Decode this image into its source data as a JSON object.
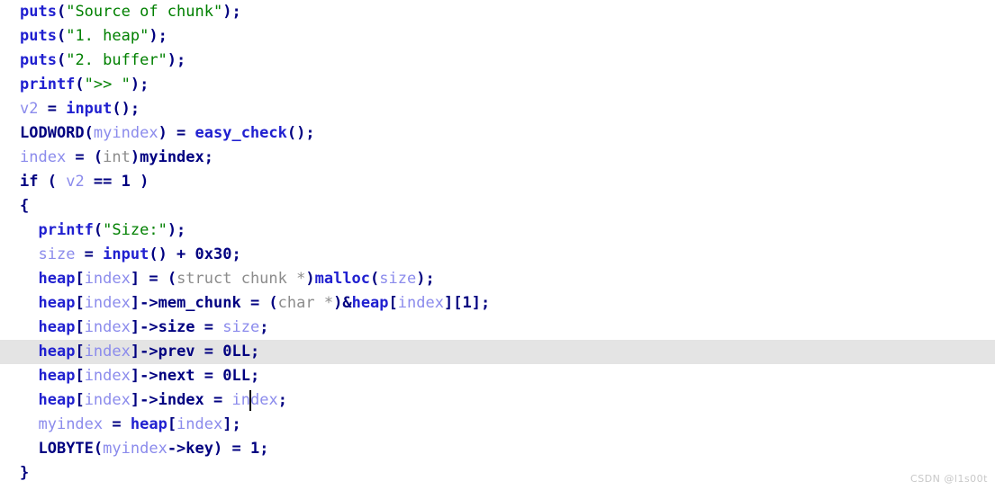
{
  "editor": {
    "kind": "decompiler-pseudocode",
    "language": "C",
    "background_color": "#ffffff",
    "highlight_color": "#e4e4e4",
    "cursor": {
      "visible": true,
      "line_number": 17,
      "column": 26
    },
    "colors": {
      "function": "#2020d0",
      "keyword": "#000080",
      "string": "#008000",
      "local_variable": "#8b8bec",
      "cast_type": "#8c8c8c",
      "number": "#000080"
    }
  },
  "lines": [
    {
      "n": 1,
      "highlighted": false,
      "tokens": [
        {
          "t": "puts",
          "c": "func"
        },
        {
          "t": "(",
          "c": "punct"
        },
        {
          "t": "\"Source of chunk\"",
          "c": "str"
        },
        {
          "t": ");",
          "c": "punct"
        }
      ]
    },
    {
      "n": 2,
      "highlighted": false,
      "tokens": [
        {
          "t": "puts",
          "c": "func"
        },
        {
          "t": "(",
          "c": "punct"
        },
        {
          "t": "\"1. heap\"",
          "c": "str"
        },
        {
          "t": ");",
          "c": "punct"
        }
      ]
    },
    {
      "n": 3,
      "highlighted": false,
      "tokens": [
        {
          "t": "puts",
          "c": "func"
        },
        {
          "t": "(",
          "c": "punct"
        },
        {
          "t": "\"2. buffer\"",
          "c": "str"
        },
        {
          "t": ");",
          "c": "punct"
        }
      ]
    },
    {
      "n": 4,
      "highlighted": false,
      "tokens": [
        {
          "t": "printf",
          "c": "func"
        },
        {
          "t": "(",
          "c": "punct"
        },
        {
          "t": "\">> \"",
          "c": "str"
        },
        {
          "t": ");",
          "c": "punct"
        }
      ]
    },
    {
      "n": 5,
      "highlighted": false,
      "tokens": [
        {
          "t": "v2",
          "c": "local"
        },
        {
          "t": " = ",
          "c": "punct"
        },
        {
          "t": "input",
          "c": "func"
        },
        {
          "t": "();",
          "c": "punct"
        }
      ]
    },
    {
      "n": 6,
      "highlighted": false,
      "tokens": [
        {
          "t": "LODWORD",
          "c": "key"
        },
        {
          "t": "(",
          "c": "punct"
        },
        {
          "t": "myindex",
          "c": "local"
        },
        {
          "t": ") = ",
          "c": "punct"
        },
        {
          "t": "easy_check",
          "c": "func"
        },
        {
          "t": "();",
          "c": "punct"
        }
      ]
    },
    {
      "n": 7,
      "highlighted": false,
      "tokens": [
        {
          "t": "index",
          "c": "local"
        },
        {
          "t": " = (",
          "c": "punct"
        },
        {
          "t": "int",
          "c": "cast"
        },
        {
          "t": ")",
          "c": "punct"
        },
        {
          "t": "myindex",
          "c": "key"
        },
        {
          "t": ";",
          "c": "punct"
        }
      ]
    },
    {
      "n": 8,
      "highlighted": false,
      "tokens": [
        {
          "t": "if",
          "c": "key"
        },
        {
          "t": " ( ",
          "c": "punct"
        },
        {
          "t": "v2",
          "c": "local"
        },
        {
          "t": " == ",
          "c": "punct"
        },
        {
          "t": "1",
          "c": "num"
        },
        {
          "t": " )",
          "c": "punct"
        }
      ]
    },
    {
      "n": 9,
      "highlighted": false,
      "tokens": [
        {
          "t": "{",
          "c": "punct"
        }
      ]
    },
    {
      "n": 10,
      "highlighted": false,
      "tokens": [
        {
          "t": "  ",
          "c": "plain"
        },
        {
          "t": "printf",
          "c": "func"
        },
        {
          "t": "(",
          "c": "punct"
        },
        {
          "t": "\"Size:\"",
          "c": "str"
        },
        {
          "t": ");",
          "c": "punct"
        }
      ]
    },
    {
      "n": 11,
      "highlighted": false,
      "tokens": [
        {
          "t": "  ",
          "c": "plain"
        },
        {
          "t": "size",
          "c": "local"
        },
        {
          "t": " = ",
          "c": "punct"
        },
        {
          "t": "input",
          "c": "func"
        },
        {
          "t": "() + ",
          "c": "punct"
        },
        {
          "t": "0x30",
          "c": "num"
        },
        {
          "t": ";",
          "c": "punct"
        }
      ]
    },
    {
      "n": 12,
      "highlighted": false,
      "tokens": [
        {
          "t": "  ",
          "c": "plain"
        },
        {
          "t": "heap",
          "c": "func"
        },
        {
          "t": "[",
          "c": "punct"
        },
        {
          "t": "index",
          "c": "local"
        },
        {
          "t": "] = (",
          "c": "punct"
        },
        {
          "t": "struct chunk *",
          "c": "cast"
        },
        {
          "t": ")",
          "c": "punct"
        },
        {
          "t": "malloc",
          "c": "func"
        },
        {
          "t": "(",
          "c": "punct"
        },
        {
          "t": "size",
          "c": "local"
        },
        {
          "t": ");",
          "c": "punct"
        }
      ]
    },
    {
      "n": 13,
      "highlighted": false,
      "tokens": [
        {
          "t": "  ",
          "c": "plain"
        },
        {
          "t": "heap",
          "c": "func"
        },
        {
          "t": "[",
          "c": "punct"
        },
        {
          "t": "index",
          "c": "local"
        },
        {
          "t": "]->",
          "c": "punct"
        },
        {
          "t": "mem_chunk",
          "c": "key"
        },
        {
          "t": " = (",
          "c": "punct"
        },
        {
          "t": "char *",
          "c": "cast"
        },
        {
          "t": ")&",
          "c": "punct"
        },
        {
          "t": "heap",
          "c": "func"
        },
        {
          "t": "[",
          "c": "punct"
        },
        {
          "t": "index",
          "c": "local"
        },
        {
          "t": "][",
          "c": "punct"
        },
        {
          "t": "1",
          "c": "num"
        },
        {
          "t": "];",
          "c": "punct"
        }
      ]
    },
    {
      "n": 14,
      "highlighted": false,
      "tokens": [
        {
          "t": "  ",
          "c": "plain"
        },
        {
          "t": "heap",
          "c": "func"
        },
        {
          "t": "[",
          "c": "punct"
        },
        {
          "t": "index",
          "c": "local"
        },
        {
          "t": "]->",
          "c": "punct"
        },
        {
          "t": "size",
          "c": "key"
        },
        {
          "t": " = ",
          "c": "punct"
        },
        {
          "t": "size",
          "c": "local"
        },
        {
          "t": ";",
          "c": "punct"
        }
      ]
    },
    {
      "n": 15,
      "highlighted": true,
      "tokens": [
        {
          "t": "  ",
          "c": "plain"
        },
        {
          "t": "heap",
          "c": "func"
        },
        {
          "t": "[",
          "c": "punct"
        },
        {
          "t": "index",
          "c": "local"
        },
        {
          "t": "]->",
          "c": "punct"
        },
        {
          "t": "prev",
          "c": "key"
        },
        {
          "t": " = ",
          "c": "punct"
        },
        {
          "t": "0LL",
          "c": "num"
        },
        {
          "t": ";",
          "c": "punct"
        }
      ]
    },
    {
      "n": 16,
      "highlighted": false,
      "tokens": [
        {
          "t": "  ",
          "c": "plain"
        },
        {
          "t": "heap",
          "c": "func"
        },
        {
          "t": "[",
          "c": "punct"
        },
        {
          "t": "index",
          "c": "local"
        },
        {
          "t": "]->",
          "c": "punct"
        },
        {
          "t": "next",
          "c": "key"
        },
        {
          "t": " = ",
          "c": "punct"
        },
        {
          "t": "0LL",
          "c": "num"
        },
        {
          "t": ";",
          "c": "punct"
        }
      ]
    },
    {
      "n": 17,
      "highlighted": false,
      "tokens": [
        {
          "t": "  ",
          "c": "plain"
        },
        {
          "t": "heap",
          "c": "func"
        },
        {
          "t": "[",
          "c": "punct"
        },
        {
          "t": "index",
          "c": "local"
        },
        {
          "t": "]->",
          "c": "punct"
        },
        {
          "t": "index",
          "c": "key"
        },
        {
          "t": " = ",
          "c": "punct"
        },
        {
          "t": "index",
          "c": "local"
        },
        {
          "t": ";",
          "c": "punct"
        }
      ]
    },
    {
      "n": 18,
      "highlighted": false,
      "tokens": [
        {
          "t": "  ",
          "c": "plain"
        },
        {
          "t": "myindex",
          "c": "local"
        },
        {
          "t": " = ",
          "c": "punct"
        },
        {
          "t": "heap",
          "c": "func"
        },
        {
          "t": "[",
          "c": "punct"
        },
        {
          "t": "index",
          "c": "local"
        },
        {
          "t": "];",
          "c": "punct"
        }
      ]
    },
    {
      "n": 19,
      "highlighted": false,
      "tokens": [
        {
          "t": "  ",
          "c": "plain"
        },
        {
          "t": "LOBYTE",
          "c": "key"
        },
        {
          "t": "(",
          "c": "punct"
        },
        {
          "t": "myindex",
          "c": "local"
        },
        {
          "t": "->",
          "c": "punct"
        },
        {
          "t": "key",
          "c": "key"
        },
        {
          "t": ") = ",
          "c": "punct"
        },
        {
          "t": "1",
          "c": "num"
        },
        {
          "t": ";",
          "c": "punct"
        }
      ]
    },
    {
      "n": 20,
      "highlighted": false,
      "tokens": [
        {
          "t": "}",
          "c": "punct"
        }
      ]
    }
  ],
  "watermark": {
    "text": "CSDN @l1s00t"
  }
}
